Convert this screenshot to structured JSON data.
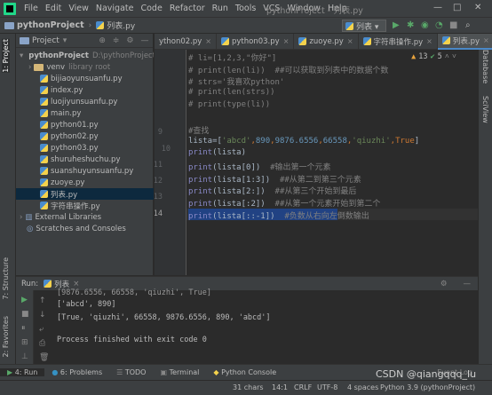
{
  "menubar": {
    "items": [
      "File",
      "Edit",
      "View",
      "Navigate",
      "Code",
      "Refactor",
      "Run",
      "Tools",
      "VCS",
      "Window",
      "Help"
    ],
    "window_title": "pythonProject - 列表.py",
    "minimize": "—",
    "maximize": "□",
    "close": "✕"
  },
  "navbar": {
    "project": "pythonProject",
    "separator": "›",
    "file": "列表.py",
    "run_config": "列表 ▾"
  },
  "left_strip": {
    "project_tab": "1: Project",
    "structure_tab": "7: Structure",
    "favorites_tab": "2: Favorites"
  },
  "right_strip": {
    "database_tab": "Database",
    "sciview_tab": "SciView"
  },
  "project_panel": {
    "title": "Project",
    "root": "pythonProject",
    "root_path": "D:\\pythonProject",
    "venv": "venv",
    "venv_hint": "library root",
    "files": [
      "bijiaoyunsuanfu.py",
      "index.py",
      "luojiyunsuanfu.py",
      "main.py",
      "python01.py",
      "python02.py",
      "python03.py",
      "shuruheshuchu.py",
      "suanshuyunsuanfu.py",
      "zuoye.py",
      "列表.py",
      "字符串操作.py"
    ],
    "external_libraries": "External Libraries",
    "scratches": "Scratches and Consoles"
  },
  "tabs": [
    {
      "label": "ython02.py"
    },
    {
      "label": "python03.py"
    },
    {
      "label": "zuoye.py"
    },
    {
      "label": "字符串操作.py"
    },
    {
      "label": "列表.py"
    }
  ],
  "editor": {
    "inspection": {
      "warnings": "13",
      "typos": "5"
    },
    "line_numbers": [
      "9",
      "10",
      "11",
      "12",
      "13",
      "14"
    ],
    "lines": {
      "l1": "# li=[1,2,3,\"你好\"]",
      "l2": "# print(len(li))  ##可以获取到列表中的数据个数",
      "l3": "# strs='我喜欢python'",
      "l4": "# print(len(strs))",
      "l5": "# print(type(li))",
      "l6": "#查找",
      "l7_a": "lista=[",
      "l7_s1": "'abcd'",
      "l7_c1": ",",
      "l7_n1": "890",
      "l7_c2": ",",
      "l7_n2": "9876.6556",
      "l7_c3": ",",
      "l7_n3": "66558",
      "l7_c4": ",",
      "l7_s2": "'qiuzhi'",
      "l7_c5": ",",
      "l7_k": "True",
      "l7_b": "]",
      "l8_fn": "print",
      "l8_rest": "(lista)",
      "l9_fn": "print",
      "l9_rest": "(lista[0])  ",
      "l9_cmt": "#输出第一个元素",
      "l10_fn": "print",
      "l10_rest": "(lista[1:3])  ",
      "l10_cmt": "##从第二到第三个元素",
      "l11_fn": "print",
      "l11_rest": "(lista[2:])  ",
      "l11_cmt": "##从第三个开始到最后",
      "l12_fn": "print",
      "l12_rest": "(lista[:2])  ",
      "l12_cmt": "##从第一个元素开始到第二个",
      "l13_fn": "print",
      "l13_rest": "(lista[::-1])  ",
      "l13_cmt": "#负数从右向左倒数输出"
    }
  },
  "run_panel": {
    "label": "Run:",
    "config": "列表",
    "output": [
      "[9876.6556, 66558, 'qiuzhi', True]",
      "['abcd', 890]",
      "[True, 'qiuzhi', 66558, 9876.6556, 890, 'abcd']",
      "",
      "Process finished with exit code 0"
    ]
  },
  "bottom_tabs": [
    "4: Run",
    "6: Problems",
    "TODO",
    "Terminal",
    "Python Console",
    "Event Log"
  ],
  "statusbar": {
    "chars": "31 chars",
    "position": "14:1",
    "line_sep": "CRLF",
    "encoding": "UTF-8",
    "indent": "4 spaces",
    "interpreter": "Python 3.9 (pythonProject)"
  },
  "watermark": "CSDN @qiangqqq_lu",
  "colors": {
    "accent": "#4a88c7",
    "comment": "#808080",
    "string": "#6a8759",
    "number": "#6897bb",
    "keyword": "#cc7832"
  }
}
